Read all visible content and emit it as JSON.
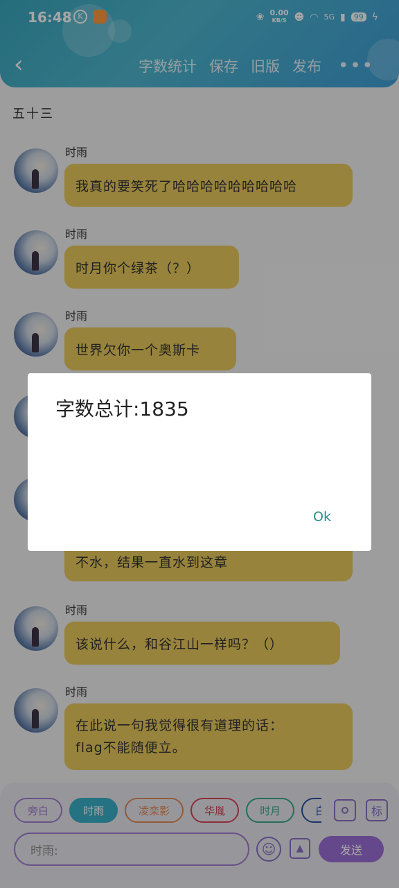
{
  "status_bar": {
    "time": "16:48",
    "app_icon_1": "K",
    "speed_value": "0.00",
    "speed_unit": "KB/S",
    "network": "5G",
    "battery": "99"
  },
  "header": {
    "back_icon": "chevron-left-icon",
    "actions": [
      "字数统计",
      "保存",
      "旧版",
      "发布"
    ],
    "more_icon": "more-dots-icon"
  },
  "chapter_title": "五十三",
  "messages": [
    {
      "sender": "时雨",
      "text": "我真的要笑死了哈哈哈哈哈哈哈哈哈"
    },
    {
      "sender": "时雨",
      "text": "时月你个绿茶（？）"
    },
    {
      "sender": "时雨",
      "text": "世界欠你一个奥斯卡"
    },
    {
      "sender": "时雨",
      "text": "不水，结果一直水到这章"
    },
    {
      "sender": "时雨",
      "text": "该说什么，和谷江山一样吗？（）"
    },
    {
      "sender": "时雨",
      "text_lines": [
        "在此说一句我觉得很有道理的话：",
        "flag不能随便立。"
      ]
    }
  ],
  "dialog": {
    "message": "字数总计:1835",
    "ok_label": "Ok"
  },
  "composer": {
    "characters": [
      {
        "label": "旁白",
        "color": "#a27fd2",
        "active": false
      },
      {
        "label": "时雨",
        "color": "#3ab0c8",
        "active": true
      },
      {
        "label": "凌栾影",
        "color": "#e08a5a",
        "active": false
      },
      {
        "label": "华胤",
        "color": "#d9445a",
        "active": false
      },
      {
        "label": "时月",
        "color": "#3aa88a",
        "active": false
      },
      {
        "label": "白",
        "color": "#2a4fa8",
        "active": false
      }
    ],
    "icon_1": "user-card-icon",
    "icon_2": "tag-icon",
    "icon_2_glyph": "标",
    "input_placeholder": "时雨:",
    "emoji_icon": "emoji-icon",
    "image_icon": "image-icon",
    "send_label": "发送"
  },
  "colors": {
    "header": "#3aa7bf",
    "bubble": "#e8c95c",
    "accent": "#9a6fd6"
  }
}
